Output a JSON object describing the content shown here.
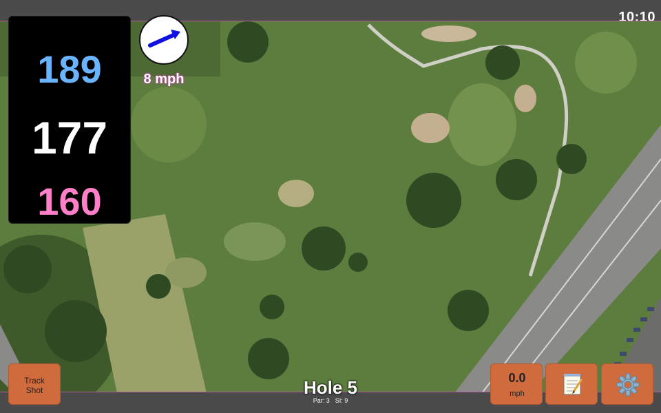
{
  "status": {
    "time": "10:10"
  },
  "distances": {
    "back": "189",
    "middle": "177",
    "front": "160"
  },
  "wind": {
    "speed_label": "8 mph",
    "icon": "wind-direction-arrow-icon"
  },
  "hole": {
    "title": "Hole 5",
    "par": "Par: 3",
    "stroke_index": "SI: 9"
  },
  "buttons": {
    "track_shot": {
      "line1": "Track",
      "line2": "Shot"
    },
    "speed": {
      "value": "0.0",
      "unit": "mph"
    },
    "notes": {
      "icon": "notepad-icon"
    },
    "settings": {
      "icon": "gear-icon"
    }
  },
  "colors": {
    "back_distance": "#6ab4ff",
    "middle_distance": "#ffffff",
    "front_distance": "#ff7fc8",
    "button_bg": "#cf6b3c",
    "accent_border": "#c05aa0"
  }
}
